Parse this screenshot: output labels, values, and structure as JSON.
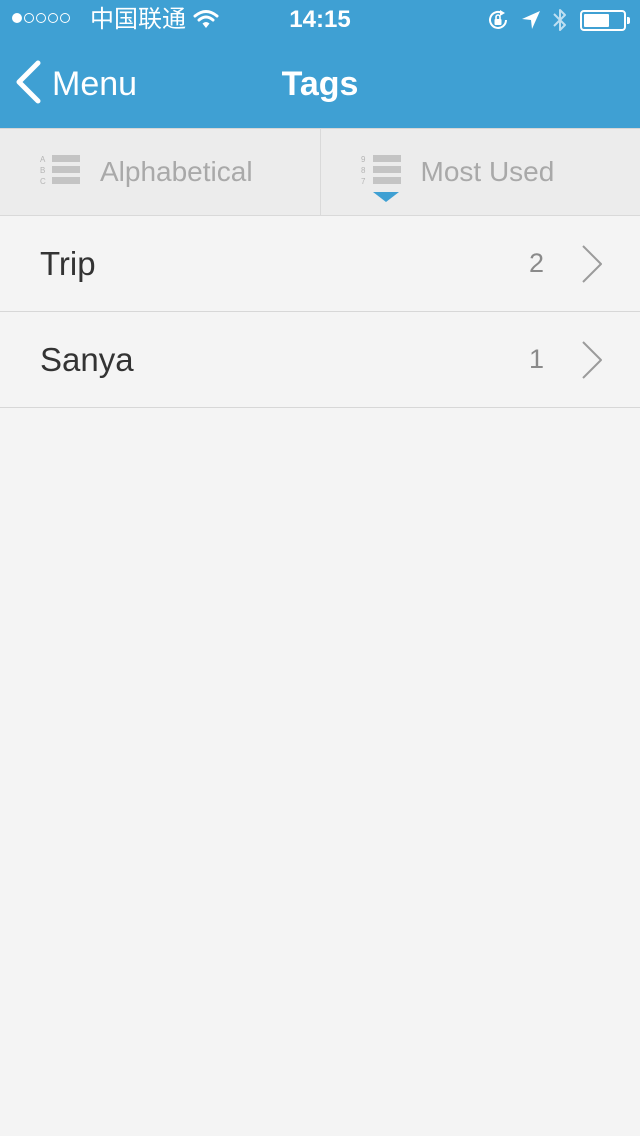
{
  "status_bar": {
    "carrier": "中国联通",
    "time": "14:15",
    "signal_bars_filled": 1,
    "signal_bars_total": 5,
    "battery_level": 0.6
  },
  "nav": {
    "back_label": "Menu",
    "title": "Tags"
  },
  "sort": {
    "options": [
      {
        "label": "Alphabetical"
      },
      {
        "label": "Most Used"
      }
    ],
    "icon_alpha_letters": [
      "A",
      "B",
      "C"
    ],
    "icon_num_digits": [
      "9",
      "8",
      "7"
    ]
  },
  "tags": [
    {
      "name": "Trip",
      "count": "2"
    },
    {
      "name": "Sanya",
      "count": "1"
    }
  ],
  "colors": {
    "accent": "#3fa0d3",
    "background": "#f4f4f4",
    "sort_bar": "#ececec",
    "muted_text": "#a9a9a9",
    "primary_text": "#333333"
  },
  "icons": {
    "back": "chevron-left-icon",
    "row_disclosure": "chevron-right-icon",
    "wifi": "wifi-icon",
    "rotation_lock": "rotation-lock-icon",
    "location": "location-arrow-icon",
    "bluetooth": "bluetooth-icon",
    "battery": "battery-icon",
    "alphabetical": "alphabetical-list-icon",
    "most_used": "numbered-list-icon"
  }
}
